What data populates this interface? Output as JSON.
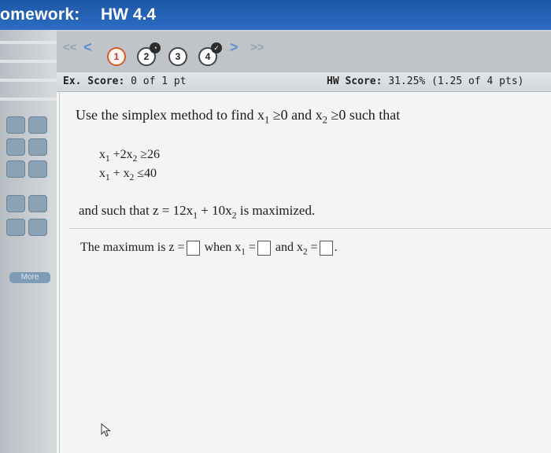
{
  "window": {
    "title_prefix": "omework:",
    "title": "HW 4.4"
  },
  "nav": {
    "prev_double": "<<",
    "prev": "<",
    "questions": [
      {
        "label": "1",
        "state": "current"
      },
      {
        "label": "2",
        "state": "partial"
      },
      {
        "label": "3",
        "state": "unanswered"
      },
      {
        "label": "4",
        "state": "answered"
      }
    ],
    "next": ">",
    "next_double": ">>"
  },
  "scores": {
    "ex_label": "Ex. Score:",
    "ex_value": "0 of 1 pt",
    "hw_label": "HW Score:",
    "hw_value": "31.25% (1.25 of 4 pts)"
  },
  "sidebar": {
    "more_label": "More"
  },
  "problem": {
    "statement": {
      "pre": "Use the simplex method to find x",
      "sub1": "1",
      "mid": " ≥0 and x",
      "sub2": "2",
      "post": " ≥0 such that"
    },
    "constraint1": {
      "a": "x",
      "a_sub": "1",
      "b": " +2x",
      "b_sub": "2",
      "rhs": " ≥26"
    },
    "constraint2": {
      "a": "x",
      "a_sub": "1",
      "b": " + x",
      "b_sub": "2",
      "rhs": " ≤40"
    },
    "objective": {
      "pre": "and such that z = 12x",
      "sub1": "1",
      "mid": " + 10x",
      "sub2": "2",
      "post": " is maximized."
    },
    "answer": {
      "pre": "The maximum is z =",
      "when": " when x",
      "sub1": "1",
      "eq1": " =",
      "and": " and x",
      "sub2": "2",
      "eq2": " =",
      "end": "."
    }
  },
  "colors": {
    "titlebar": "#2a66bd",
    "nav_arrow": "#5b8fd0",
    "current_question": "#d25b2c"
  }
}
